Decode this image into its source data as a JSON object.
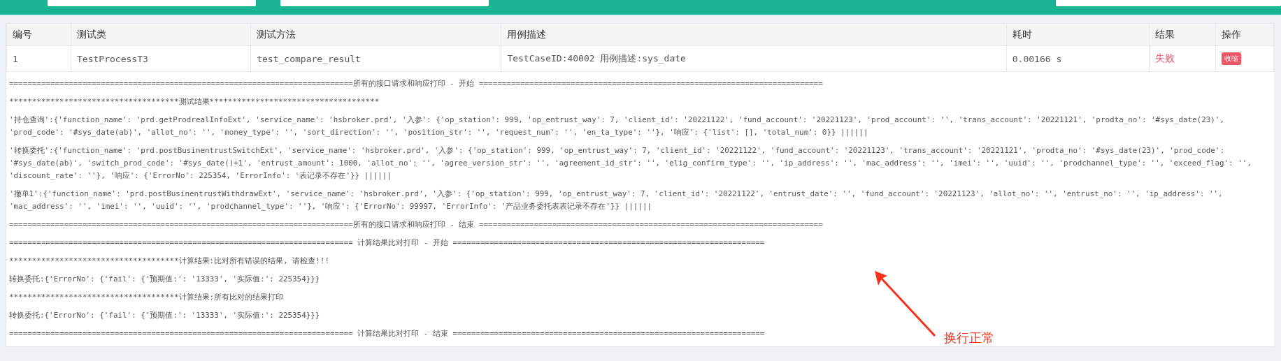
{
  "table": {
    "columns": [
      "编号",
      "测试类",
      "测试方法",
      "用例描述",
      "耗时",
      "结果",
      "操作"
    ],
    "rows": [
      {
        "cells": [
          "1",
          "TestProcessT3",
          "test_compare_result",
          "TestCaseID:40002 用例描述:sys_date",
          "0.00166 s"
        ],
        "result": "失败",
        "action": "收缩"
      }
    ]
  },
  "log": {
    "lines": [
      "===========================================================================所有的接口请求和响应打印 - 开始 ===========================================================================",
      "*************************************测试结果*************************************",
      "'持仓查询':{'function_name': 'prd.getProdrealInfoExt', 'service_name': 'hsbroker.prd', '入参': {'op_station': 999, 'op_entrust_way': 7, 'client_id': '20221122', 'fund_account': '20221123', 'prod_account': '', 'trans_account': '20221121', 'prodta_no': '#sys_date(23)', 'prod_code': '#sys_date(ab)', 'allot_no': '', 'money_type': '', 'sort_direction': '', 'position_str': '', 'request_num': '', 'en_ta_type': ''}, '响应': {'list': [], 'total_num': 0}} ||||||",
      "'转换委托':{'function_name': 'prd.postBusinentrustSwitchExt', 'service_name': 'hsbroker.prd', '入参': {'op_station': 999, 'op_entrust_way': 7, 'client_id': '20221122', 'fund_account': '20221123', 'trans_account': '20221121', 'prodta_no': '#sys_date(23)', 'prod_code': '#sys_date(ab)', 'switch_prod_code': '#sys_date()+1', 'entrust_amount': 1000, 'allot_no': '', 'agree_version_str': '', 'agreement_id_str': '', 'elig_confirm_type': '', 'ip_address': '', 'mac_address': '', 'imei': '', 'uuid': '', 'prodchannel_type': '', 'exceed_flag': '', 'discount_rate': ''}, '响应': {'ErrorNo': 225354, 'ErrorInfo': '表记录不存在'}} ||||||",
      "'撤单1':{'function_name': 'prd.postBusinentrustWithdrawExt', 'service_name': 'hsbroker.prd', '入参': {'op_station': 999, 'op_entrust_way': 7, 'client_id': '20221122', 'entrust_date': '', 'fund_account': '20221123', 'allot_no': '', 'entrust_no': '', 'ip_address': '', 'mac_address': '', 'imei': '', 'uuid': '', 'prodchannel_type': ''}, '响应': {'ErrorNo': 99997, 'ErrorInfo': '产品业务委托表表记录不存在'}} ||||||",
      "===========================================================================所有的接口请求和响应打印 - 结束 ===========================================================================",
      "=========================================================================== 计算结果比对打印 - 开始 ====================================================================",
      "*************************************计算结果:比对所有错误的结果, 请检查!!!",
      "转换委托:{'ErrorNo': {'fail': {'预期值:': '13333', '实际值:': 225354}}}",
      "*************************************计算结果:所有比对的结果打印",
      "转换委托:{'ErrorNo': {'fail': {'预期值:': '13333', '实际值:': 225354}}}",
      "=========================================================================== 计算结果比对打印 - 结束 ===================================================================="
    ]
  },
  "annotation": {
    "text": "换行正常"
  }
}
